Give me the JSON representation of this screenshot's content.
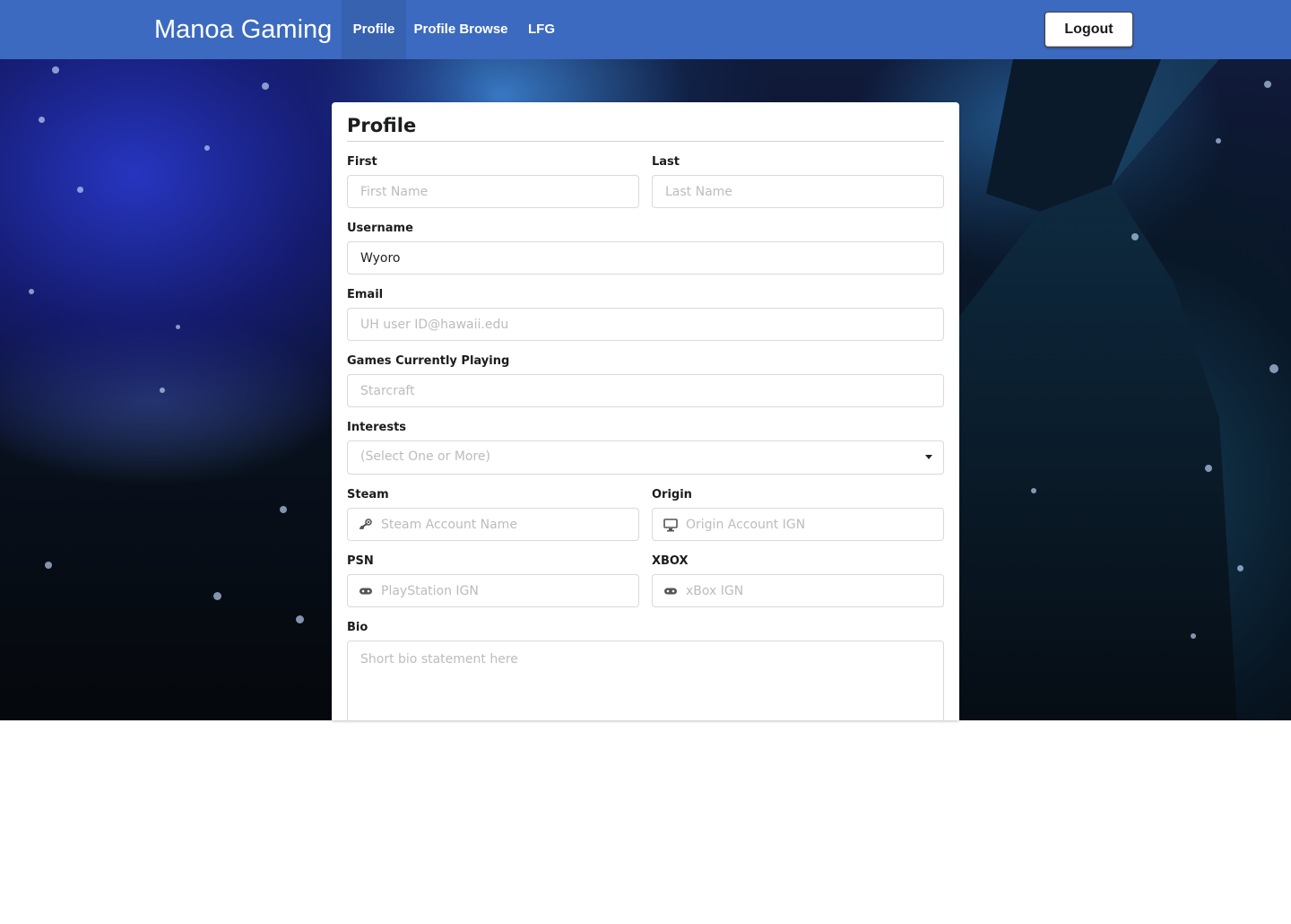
{
  "nav": {
    "brand": "Manoa Gaming",
    "items": [
      {
        "label": "Profile",
        "active": true
      },
      {
        "label": "Profile Browse",
        "active": false
      },
      {
        "label": "LFG",
        "active": false
      }
    ],
    "logout_label": "Logout",
    "bar_color": "#3c6ac0"
  },
  "form": {
    "title": "Profile",
    "first": {
      "label": "First",
      "value": "",
      "placeholder": "First Name"
    },
    "last": {
      "label": "Last",
      "value": "",
      "placeholder": "Last Name"
    },
    "username": {
      "label": "Username",
      "value": "Wyoro",
      "placeholder": ""
    },
    "email": {
      "label": "Email",
      "value": "",
      "placeholder": "UH user ID@hawaii.edu"
    },
    "games": {
      "label": "Games Currently Playing",
      "value": "",
      "placeholder": "Starcraft"
    },
    "interests": {
      "label": "Interests",
      "selected": "(Select One or More)"
    },
    "steam": {
      "label": "Steam",
      "value": "",
      "placeholder": "Steam Account Name",
      "icon": "steam-icon"
    },
    "origin": {
      "label": "Origin",
      "value": "",
      "placeholder": "Origin Account IGN",
      "icon": "desktop-icon"
    },
    "psn": {
      "label": "PSN",
      "value": "",
      "placeholder": "PlayStation IGN",
      "icon": "gamepad-icon"
    },
    "xbox": {
      "label": "XBOX",
      "value": "",
      "placeholder": "xBox IGN",
      "icon": "gamepad-icon"
    },
    "bio": {
      "label": "Bio",
      "value": "",
      "placeholder": "Short bio statement here"
    }
  }
}
